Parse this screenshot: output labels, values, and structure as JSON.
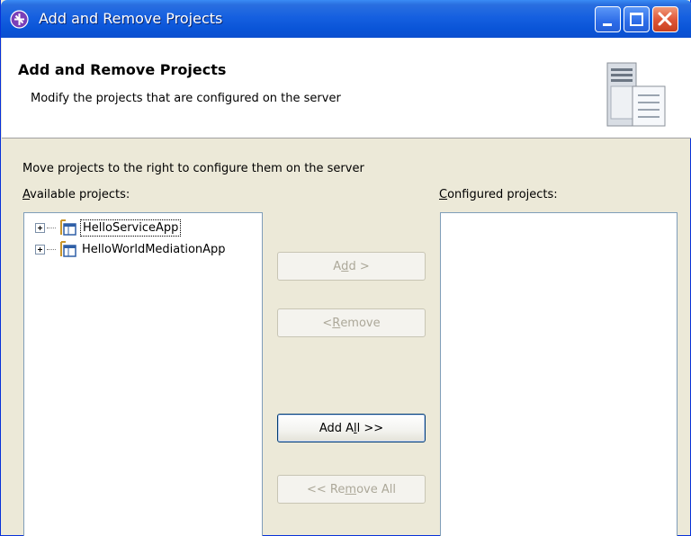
{
  "window": {
    "title": "Add and Remove Projects"
  },
  "header": {
    "title": "Add and Remove Projects",
    "description": "Modify the projects that are configured on the server"
  },
  "instructions": "Move projects to the right to configure them on the server",
  "available": {
    "label_mnemonic": "A",
    "label_rest": "vailable projects:",
    "items": [
      {
        "label": "HelloServiceApp",
        "focused": true
      },
      {
        "label": "HelloWorldMediationApp",
        "focused": false
      }
    ]
  },
  "configured": {
    "label_mnemonic": "C",
    "label_rest": "onfigured projects:",
    "items": []
  },
  "buttons": {
    "add": {
      "pre": "A",
      "mnemonic": "d",
      "post": "d >",
      "enabled": false
    },
    "remove": {
      "pre": "< ",
      "mnemonic": "R",
      "post": "emove",
      "enabled": false
    },
    "add_all": {
      "pre": "Add A",
      "mnemonic": "l",
      "post": "l >>",
      "enabled": true
    },
    "remove_all": {
      "pre": "<< Re",
      "mnemonic": "m",
      "post": "ove All",
      "enabled": false
    }
  },
  "icons": {
    "app": "wizard-app-icon",
    "minimize": "minimize-icon",
    "maximize": "maximize-icon",
    "close": "close-icon",
    "header": "server-icon",
    "tree_expand": "plus-box-icon",
    "project": "enterprise-application-icon"
  },
  "colors": {
    "titlebar": "#0a55d8",
    "dialog_bg": "#ece9d8",
    "disabled_text": "#aca899",
    "list_border": "#7f9db9"
  }
}
